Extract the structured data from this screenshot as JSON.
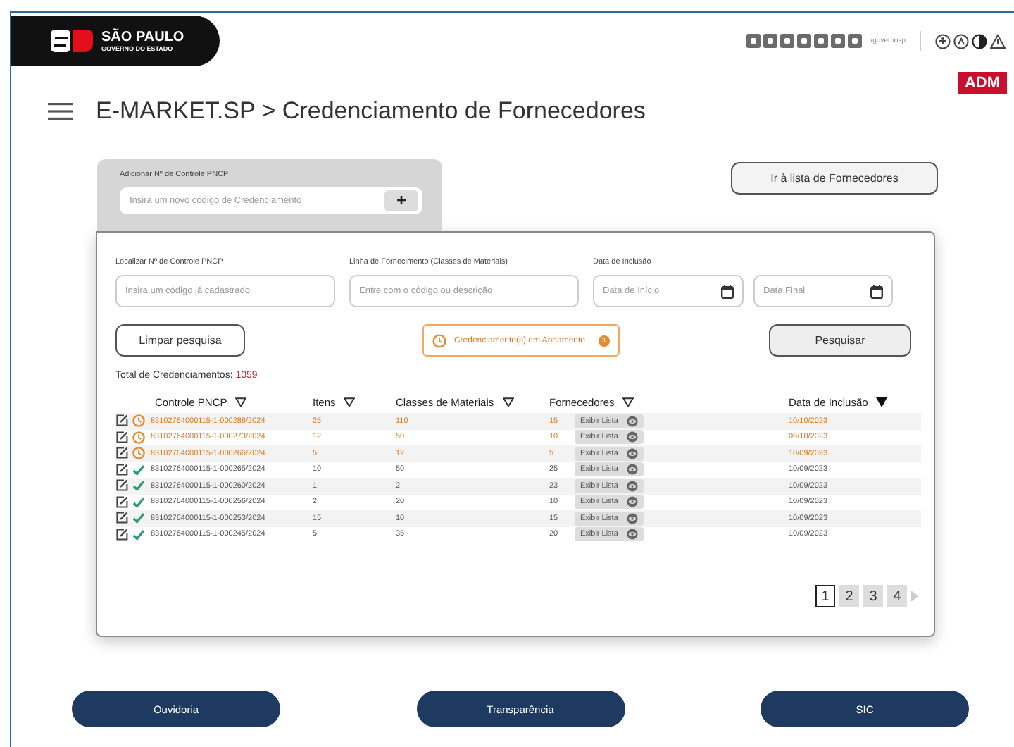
{
  "header": {
    "logo_title": "SÃO PAULO",
    "logo_subtitle": "GOVERNO DO ESTADO",
    "social_handle": "/governosp",
    "badge": "ADM"
  },
  "breadcrumb": "E-MARKET.SP > Credenciamento de Fornecedores",
  "add_panel": {
    "label": "Adicionar Nº de Controle PNCP",
    "placeholder": "Insira um novo código de  Credenciamento",
    "button": "+"
  },
  "list_button": "Ir à lista de Fornecedores",
  "filters": [
    {
      "label": "Localizar Nº de Controle PNCP",
      "placeholder": "Insira um código já cadastrado",
      "kind": "text"
    },
    {
      "label": "Linha de Fornecimento (Classes de Materiais)",
      "placeholder": "Entre com o código ou descrição",
      "kind": "text"
    },
    {
      "label": "Data de Inclusão",
      "placeholder": "Data de Início",
      "kind": "date"
    },
    {
      "placeholder": "Data Final",
      "kind": "date"
    }
  ],
  "clear_button": "Limpar pesquisa",
  "in_progress": {
    "label": "Credenciamento(s) em Andamento",
    "count": "3"
  },
  "search_button": "Pesquisar",
  "total": {
    "label": "Total de Credenciamentos:",
    "value": "1059"
  },
  "table": {
    "columns": [
      {
        "label": "Controle PNCP",
        "sorted": false
      },
      {
        "label": "Itens",
        "sorted": false
      },
      {
        "label": "Classes de Materiais",
        "sorted": false
      },
      {
        "label": "Fornecedores",
        "sorted": false
      },
      {
        "label": "Data de Inclusão",
        "sorted": true
      }
    ],
    "rows": [
      {
        "kind": "pending",
        "code": "83102764000115-1-000288/2024",
        "items": "25",
        "classes": "110",
        "suppliers": "15",
        "action": "Exibir Lista",
        "date": "10/10/2023"
      },
      {
        "kind": "pending",
        "code": "83102764000115-1-000273/2024",
        "items": "12",
        "classes": "50",
        "suppliers": "10",
        "action": "Exibir Lista",
        "date": "09/10/2023"
      },
      {
        "kind": "pending",
        "code": "83102764000115-1-000266/2024",
        "items": "5",
        "classes": "12",
        "suppliers": "5",
        "action": "Exibir Lista",
        "date": "10/09/2023"
      },
      {
        "kind": "done",
        "code": "83102764000115-1-000265/2024",
        "items": "10",
        "classes": "50",
        "suppliers": "25",
        "action": "Exibir Lista",
        "date": "10/09/2023"
      },
      {
        "kind": "done",
        "code": "83102764000115-1-000260/2024",
        "items": "1",
        "classes": "2",
        "suppliers": "23",
        "action": "Exibir Lista",
        "date": "10/09/2023"
      },
      {
        "kind": "done",
        "code": "83102764000115-1-000256/2024",
        "items": "2",
        "classes": "20",
        "suppliers": "10",
        "action": "Exibir Lista",
        "date": "10/09/2023"
      },
      {
        "kind": "done",
        "code": "83102764000115-1-000253/2024",
        "items": "15",
        "classes": "10",
        "suppliers": "15",
        "action": "Exibir Lista",
        "date": "10/09/2023"
      },
      {
        "kind": "done",
        "code": "83102764000115-1-000245/2024",
        "items": "5",
        "classes": "35",
        "suppliers": "20",
        "action": "Exibir Lista",
        "date": "10/09/2023"
      }
    ]
  },
  "pagination": [
    {
      "label": "1",
      "selected": true
    },
    {
      "label": "2",
      "selected": false
    },
    {
      "label": "3",
      "selected": false
    },
    {
      "label": "4",
      "selected": false
    }
  ],
  "footer_links": [
    "Ouvidoria",
    "Transparência",
    "SIC"
  ]
}
